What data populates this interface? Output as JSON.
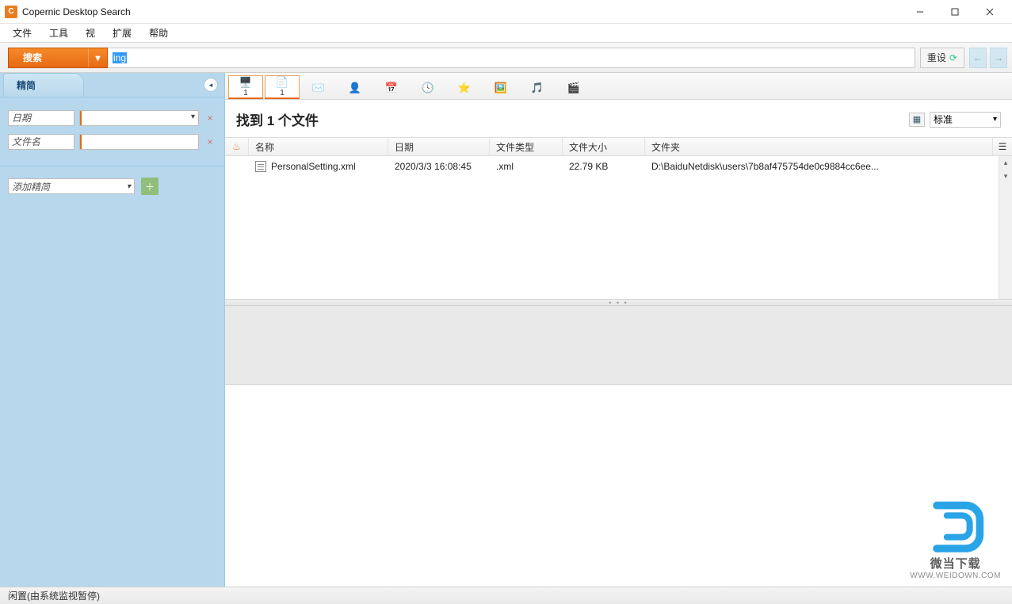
{
  "window": {
    "title": "Copernic Desktop Search"
  },
  "menu": {
    "items": [
      "文件",
      "工具",
      "视",
      "扩展",
      "帮助"
    ]
  },
  "search": {
    "button_label": "搜索",
    "query": "ing",
    "reset_label": "重设"
  },
  "sidebar": {
    "tab_label": "精简",
    "filters": [
      {
        "label": "日期"
      },
      {
        "label": "文件名"
      }
    ],
    "add_filter_label": "添加精简"
  },
  "categories": [
    {
      "icon": "🖥️",
      "count": "1",
      "name": "all"
    },
    {
      "icon": "📄",
      "count": "1",
      "name": "files"
    },
    {
      "icon": "✉️",
      "count": "",
      "name": "emails"
    },
    {
      "icon": "👤",
      "count": "",
      "name": "contacts"
    },
    {
      "icon": "📅",
      "count": "",
      "name": "calendar"
    },
    {
      "icon": "🕓",
      "count": "",
      "name": "history"
    },
    {
      "icon": "⭐",
      "count": "",
      "name": "favorites"
    },
    {
      "icon": "🖼️",
      "count": "",
      "name": "pictures"
    },
    {
      "icon": "🎵",
      "count": "",
      "name": "music"
    },
    {
      "icon": "🎬",
      "count": "",
      "name": "videos"
    }
  ],
  "results": {
    "heading": "找到 1 个文件",
    "view_mode": "标准",
    "columns": {
      "name": "名称",
      "date": "日期",
      "type": "文件类型",
      "size": "文件大小",
      "folder": "文件夹"
    },
    "rows": [
      {
        "name": "PersonalSetting.xml",
        "date": "2020/3/3 16:08:45",
        "type": ".xml",
        "size": "22.79 KB",
        "folder": "D:\\BaiduNetdisk\\users\\7b8af475754de0c9884cc6ee..."
      }
    ]
  },
  "status": {
    "text": "闲置(由系统监视暂停)"
  },
  "watermark": {
    "line1": "微当下载",
    "line2": "WWW.WEIDOWN.COM"
  }
}
